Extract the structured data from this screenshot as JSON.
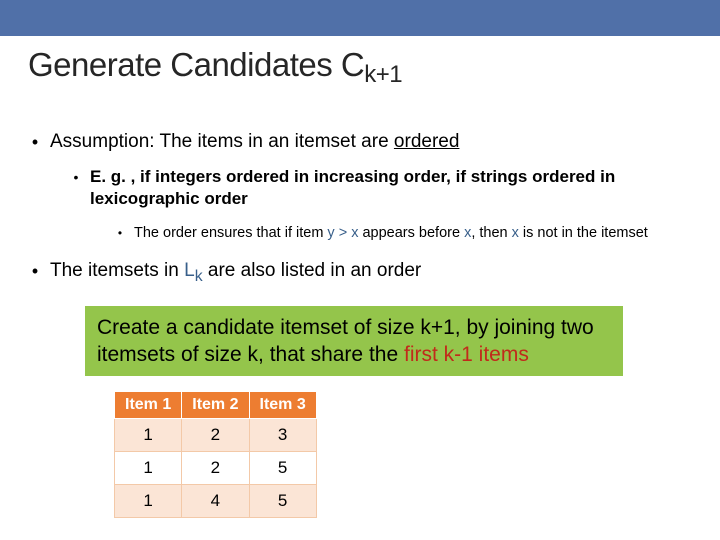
{
  "title_main": "Generate Candidates C",
  "title_sub": "k+1",
  "b1_a_pre": "Assumption: The items in an itemset are ",
  "b1_a_ord": "ordered",
  "b2_a": "E. g. , if integers ordered in increasing order, if strings ordered in lexicographic order",
  "b3_pre": "The order ensures that if item ",
  "b3_cond": "y > x",
  "b3_mid": " appears before ",
  "b3_x": "x",
  "b3_mid2": ", then ",
  "b3_x2": "x",
  "b3_post": " is not in the itemset",
  "b1_b_pre": "The itemsets in ",
  "b1_b_lk": "L",
  "b1_b_lk_sub": "k",
  "b1_b_post": " are also listed in an order",
  "callout_a": "Create a candidate itemset of size k+1, by joining two itemsets of size k, that share the ",
  "callout_b": "first k-1 items",
  "chart_data": {
    "type": "table",
    "headers": [
      "Item 1",
      "Item 2",
      "Item 3"
    ],
    "rows": [
      [
        "1",
        "2",
        "3"
      ],
      [
        "1",
        "2",
        "5"
      ],
      [
        "1",
        "4",
        "5"
      ]
    ]
  }
}
